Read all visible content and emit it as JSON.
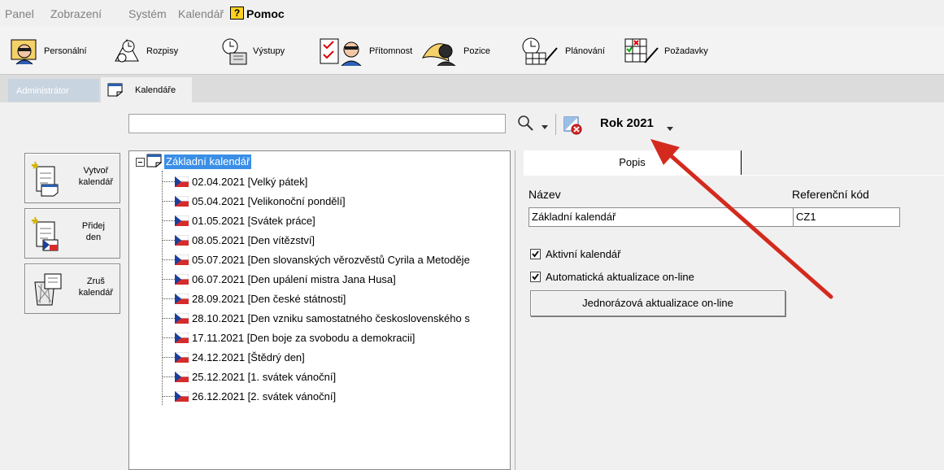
{
  "menu": {
    "items": [
      "Panel",
      "Zobrazení",
      "Systém",
      "Kalendář"
    ],
    "help_glyph": "?",
    "help": "Pomoc"
  },
  "toolbar": {
    "buttons": [
      {
        "label": "Personální",
        "icon": "personnel-icon"
      },
      {
        "label": "Rozpisy",
        "icon": "schedules-icon"
      },
      {
        "label": "Výstupy",
        "icon": "outputs-icon"
      },
      {
        "label": "Přítomnost",
        "icon": "attendance-icon"
      },
      {
        "label": "Pozice",
        "icon": "positions-icon"
      },
      {
        "label": "Plánování",
        "icon": "planning-icon"
      },
      {
        "label": "Požadavky",
        "icon": "requests-icon"
      }
    ]
  },
  "tabs": {
    "admin": "Administrátor",
    "calendars": "Kalendáře"
  },
  "search": {
    "value": "",
    "year": "Rok 2021"
  },
  "side_buttons": [
    {
      "label1": "Vytvoř",
      "label2": "kalendář"
    },
    {
      "label1": "Přidej",
      "label2": "den"
    },
    {
      "label1": "Zruš",
      "label2": "kalendář"
    }
  ],
  "tree": {
    "root": "Základní kalendář",
    "items": [
      "02.04.2021 [Velký pátek]",
      "05.04.2021 [Velikonoční pondělí]",
      "01.05.2021 [Svátek práce]",
      "08.05.2021 [Den vítězství]",
      "05.07.2021 [Den slovanských věrozvěstů Cyrila a Metoděje",
      "06.07.2021 [Den upálení mistra Jana Husa]",
      "28.09.2021 [Den české státnosti]",
      "28.10.2021 [Den vzniku samostatného československého s",
      "17.11.2021 [Den boje za svobodu a demokracii]",
      "24.12.2021 [Štědrý den]",
      "25.12.2021 [1. svátek vánoční]",
      "26.12.2021 [2. svátek vánoční]"
    ]
  },
  "panel": {
    "tab": "Popis",
    "name_label": "Název",
    "name_value": "Základní kalendář",
    "ref_label": "Referenční kód",
    "ref_value": "CZ1",
    "active_label": "Aktivní kalendář",
    "auto_label": "Automatická aktualizace on-line",
    "online_button": "Jednorázová aktualizace on-line"
  },
  "colors": {
    "selection": "#3a8ee6",
    "arrow": "#d42a1e",
    "help": "#ffd21f"
  }
}
